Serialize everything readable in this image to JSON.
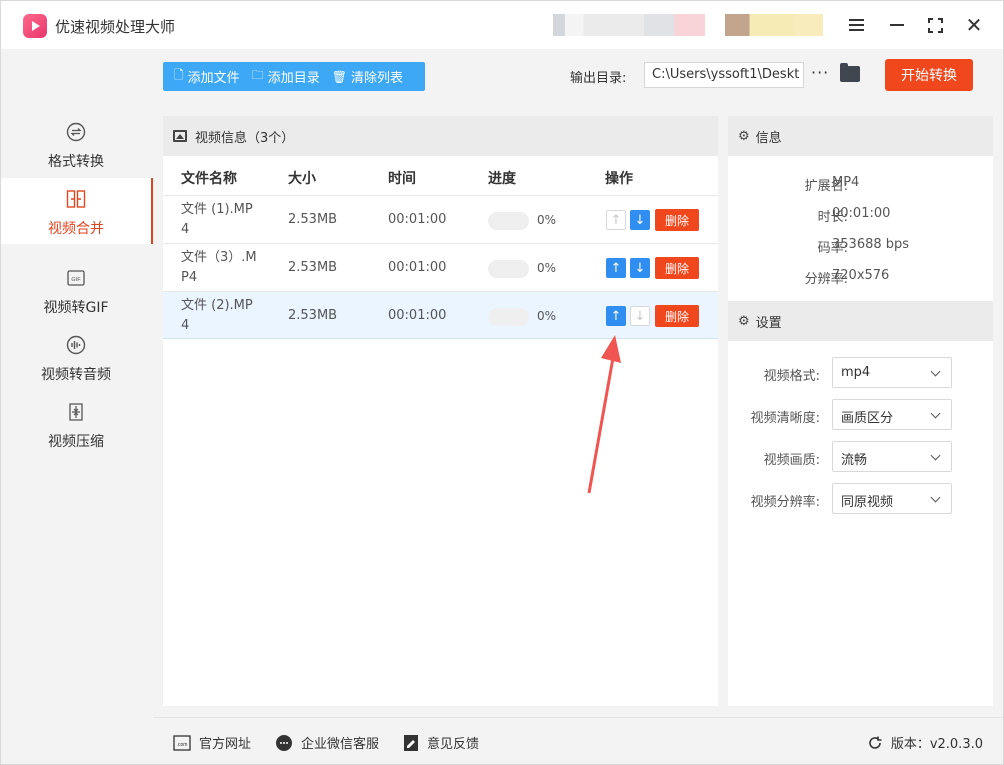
{
  "app": {
    "title": "优速视频处理大师"
  },
  "sidebar": {
    "items": [
      {
        "label": "格式转换",
        "icon": "format-convert-icon",
        "active": false
      },
      {
        "label": "视频合并",
        "icon": "video-merge-icon",
        "active": true
      },
      {
        "label": "视频转GIF",
        "icon": "gif-icon",
        "active": false
      },
      {
        "label": "视频转音频",
        "icon": "audio-icon",
        "active": false
      },
      {
        "label": "视频压缩",
        "icon": "compress-icon",
        "active": false
      }
    ]
  },
  "toolbar": {
    "add_file": "添加文件",
    "add_dir": "添加目录",
    "clear_list": "清除列表",
    "output_label": "输出目录:",
    "output_path": "C:\\Users\\yssoft1\\Deskt",
    "more": "···",
    "start": "开始转换"
  },
  "file_panel": {
    "title": "视频信息（3个）",
    "columns": [
      "文件名称",
      "大小",
      "时间",
      "进度",
      "操作"
    ],
    "rows": [
      {
        "name": "文件 (1).MP4",
        "size": "2.53MB",
        "time": "00:01:00",
        "progress": 0,
        "progress_text": "0%",
        "up_enabled": false,
        "down_enabled": true,
        "delete": "删除"
      },
      {
        "name": "文件（3）.MP4",
        "size": "2.53MB",
        "time": "00:01:00",
        "progress": 0,
        "progress_text": "0%",
        "up_enabled": true,
        "down_enabled": true,
        "delete": "删除"
      },
      {
        "name": "文件 (2).MP4",
        "size": "2.53MB",
        "time": "00:01:00",
        "progress": 0,
        "progress_text": "0%",
        "up_enabled": true,
        "down_enabled": false,
        "delete": "删除",
        "selected": true
      }
    ]
  },
  "info": {
    "title": "信息",
    "ext_label": "扩展名:",
    "ext": "MP4",
    "duration_label": "时长:",
    "duration": "00:01:00",
    "bitrate_label": "码率:",
    "bitrate": "353688 bps",
    "resolution_label": "分辨率:",
    "resolution": "720x576"
  },
  "settings": {
    "title": "设置",
    "format_label": "视频格式:",
    "format": "mp4",
    "clarity_label": "视频清晰度:",
    "clarity": "画质区分",
    "quality_label": "视频画质:",
    "quality": "流畅",
    "resolution_label": "视频分辨率:",
    "resolution": "同原视频"
  },
  "footer": {
    "website": "官方网址",
    "wechat": "企业微信客服",
    "feedback": "意见反馈",
    "version": "版本：v2.0.3.0"
  },
  "colors": {
    "accent": "#f1471d",
    "primary": "#3da8f5",
    "button_blue": "#2f8ef0"
  }
}
